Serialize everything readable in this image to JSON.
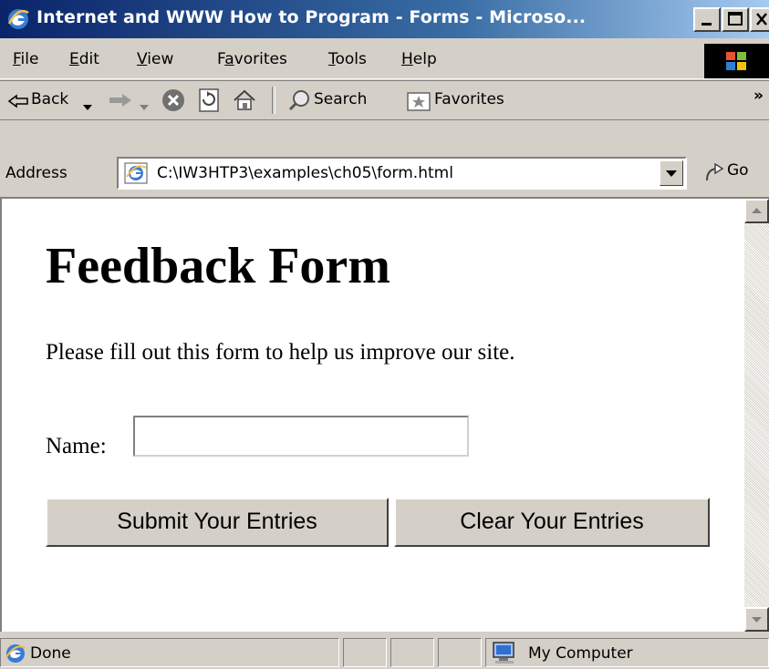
{
  "window": {
    "title": "Internet and WWW How to Program - Forms - Microso..."
  },
  "menu": {
    "items": [
      {
        "label": "File",
        "key": "F",
        "rest": "ile"
      },
      {
        "label": "Edit",
        "key": "E",
        "rest": "dit"
      },
      {
        "label": "View",
        "key": "V",
        "rest": "iew"
      },
      {
        "label": "Favorites",
        "pre": "F",
        "key": "a",
        "rest": "vorites"
      },
      {
        "label": "Tools",
        "key": "T",
        "rest": "ools"
      },
      {
        "label": "Help",
        "key": "H",
        "rest": "elp"
      }
    ]
  },
  "toolbar": {
    "back_label": "Back",
    "search_label": "Search",
    "favorites_label": "Favorites",
    "overflow": "»"
  },
  "address": {
    "label": "Address",
    "url": "C:\\IW3HTP3\\examples\\ch05\\form.html",
    "go_label": "Go"
  },
  "page": {
    "heading": "Feedback Form",
    "intro": "Please fill out this form to help us improve our site.",
    "name_label": "Name:",
    "name_value": "",
    "submit_label": "Submit Your Entries",
    "clear_label": "Clear Your Entries"
  },
  "status": {
    "text": "Done",
    "zone": "My Computer"
  },
  "colors": {
    "title_start": "#0a246a",
    "title_end": "#a6caf0",
    "chrome": "#d4d0c8"
  }
}
